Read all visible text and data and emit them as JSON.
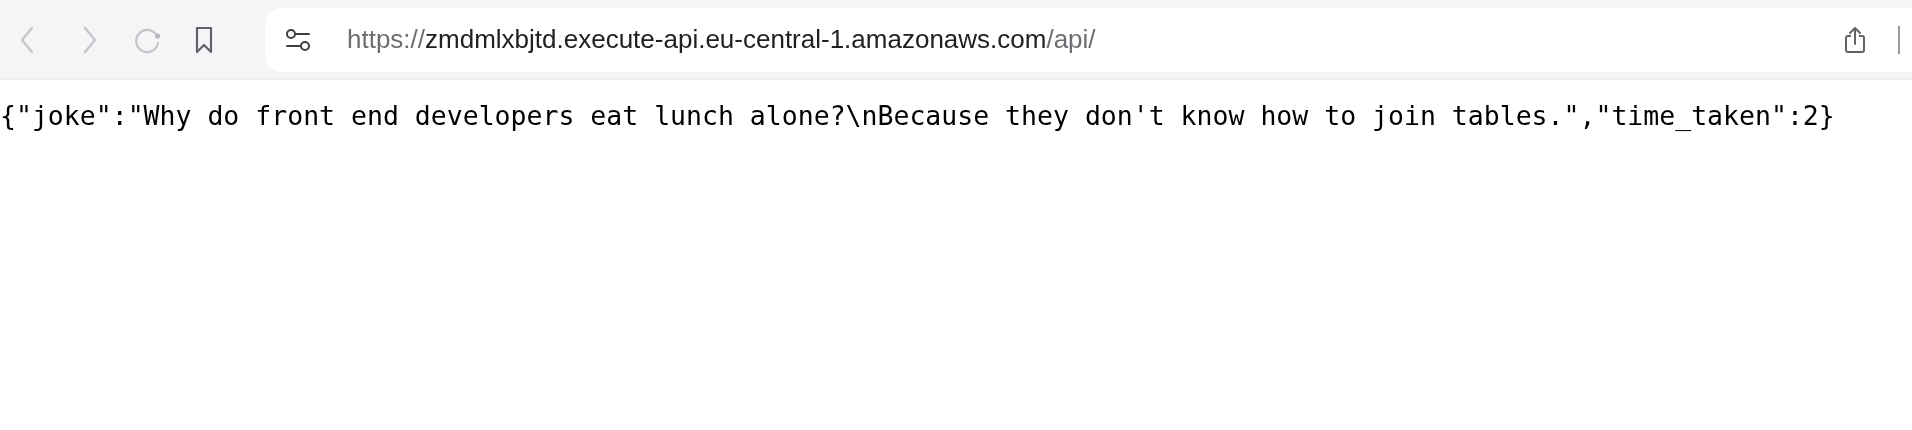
{
  "address_bar": {
    "url_scheme": "https://",
    "url_host": "zmdmlxbjtd.execute-api.eu-central-1.amazonaws.com",
    "url_path": "/api/"
  },
  "page": {
    "body_text": "{\"joke\":\"Why do front end developers eat lunch alone?\\nBecause they don't know how to join tables.\",\"time_taken\":2}"
  }
}
